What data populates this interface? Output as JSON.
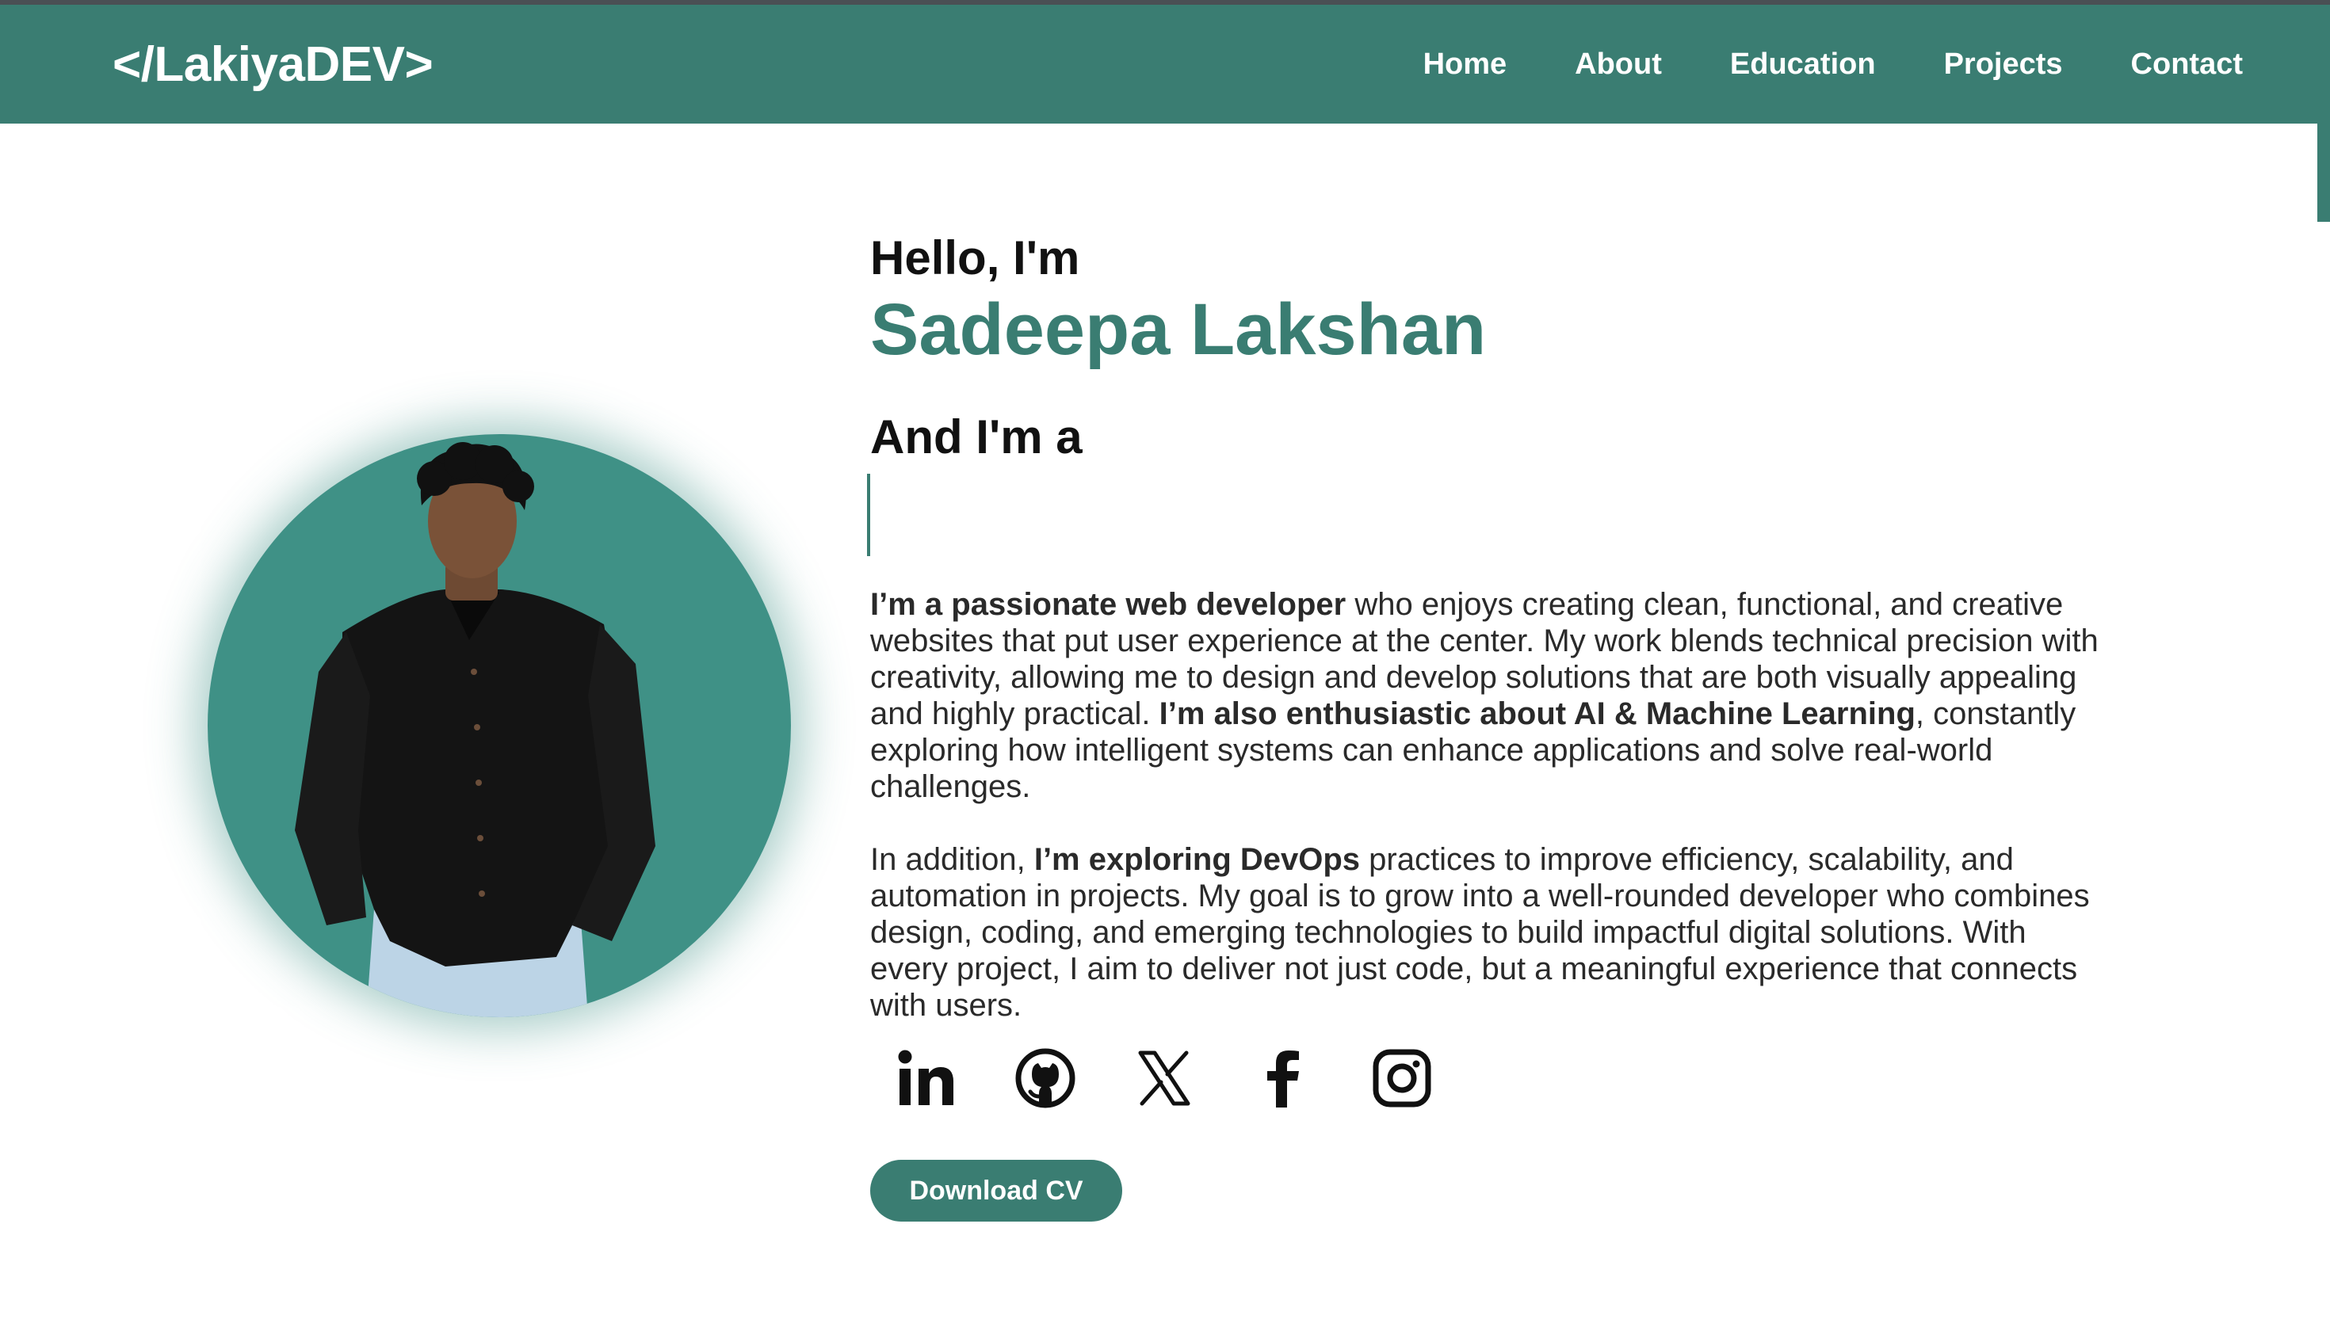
{
  "nav": {
    "logo": "</LakiyaDEV>",
    "links": [
      "Home",
      "About",
      "Education",
      "Projects",
      "Contact"
    ]
  },
  "hero": {
    "greeting": "Hello, I'm",
    "name": "Sadeepa Lakshan",
    "role_prefix": "And I'm a",
    "bio1": {
      "b1": "I’m a passionate web developer",
      "t1": " who enjoys creating clean, functional, and creative websites that put user experience at the center. My work blends technical precision with creativity, allowing me to design and develop solutions that are both visually appealing and highly practical. ",
      "b2": "I’m also enthusiastic about AI & Machine Learning",
      "t2": ", constantly exploring how intelligent systems can enhance applications and solve real-world challenges."
    },
    "bio2": {
      "t1": "In addition, ",
      "b1": "I’m exploring DevOps",
      "t2": " practices to improve efficiency, scalability, and automation in projects. My goal is to grow into a well-rounded developer who combines design, coding, and emerging technologies to build impactful digital solutions. With every project, I aim to deliver not just code, but a meaningful experience that connects with users."
    },
    "socials": [
      "linkedin-icon",
      "github-icon",
      "x-icon",
      "facebook-icon",
      "instagram-icon"
    ],
    "cv_button": "Download CV"
  },
  "colors": {
    "accent": "#3a7d72",
    "photo_bg": "#3f9186",
    "text": "#111111"
  }
}
